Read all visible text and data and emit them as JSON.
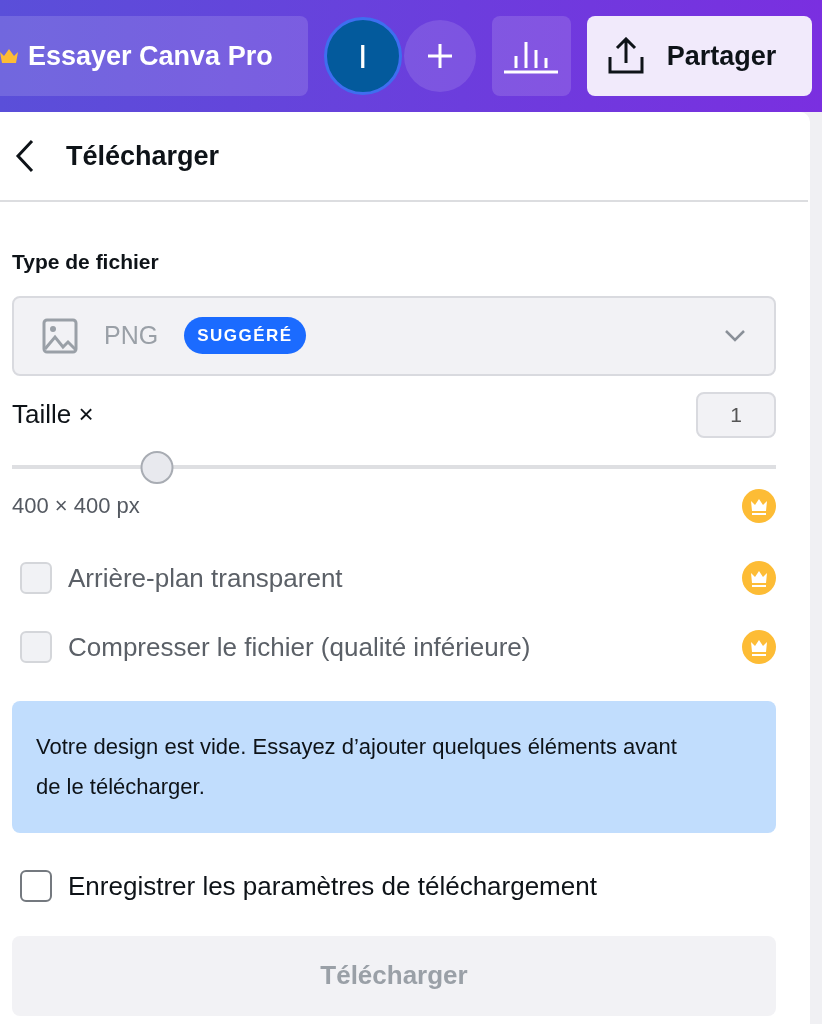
{
  "topbar": {
    "pro_button": "Essayer Canva Pro",
    "avatar": "I",
    "share_button": "Partager"
  },
  "panel": {
    "title": "Télécharger",
    "file_type": {
      "label": "Type de fichier",
      "value": "PNG",
      "badge": "SUGGÉRÉ"
    },
    "size": {
      "label": "Taille ×",
      "value": "1",
      "level": 0.19,
      "dimensions": "400 × 400 px",
      "pro": true
    },
    "options": [
      {
        "label": "Arrière-plan transparent",
        "checked": false,
        "disabled": true,
        "pro": true
      },
      {
        "label": "Compresser le fichier (qualité inférieure)",
        "checked": false,
        "disabled": true,
        "pro": true
      }
    ],
    "notice": "Votre design est vide. Essayez d’ajouter quelques éléments avant de le télécharger.",
    "save_settings": {
      "label": "Enregistrer les paramètres de téléchargement",
      "checked": false,
      "disabled": false
    },
    "download_button": {
      "label": "Télécharger",
      "disabled": true
    }
  }
}
